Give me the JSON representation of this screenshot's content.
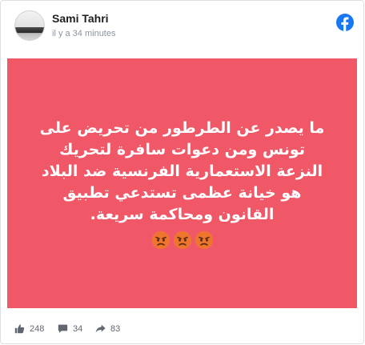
{
  "post": {
    "author": "Sami Tahri",
    "timestamp": "il y a 34 minutes",
    "text": "ما يصدر عن الطرطور من تحريض على تونس ومن دعوات سافرة لتحريك النزعة الاستعمارية الفرنسية ضد البلاد هو خيانة عظمى تستدعي تطبيق القانون ومحاكمة سريعة.",
    "background_color": "#f05868",
    "emojis": [
      "angry-face-icon",
      "angry-face-icon",
      "angry-face-icon"
    ]
  },
  "stats": {
    "likes": "248",
    "comments": "34",
    "shares": "83"
  },
  "brand": {
    "platform_icon": "facebook-icon",
    "color": "#1877f2"
  }
}
